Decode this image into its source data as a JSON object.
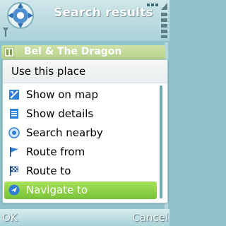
{
  "header": {
    "title": "Search results",
    "app_icon": "gps-globe-icon",
    "signal_icon": "signal-icon",
    "battery_icon": "battery-icon",
    "connection_icon": "connection-icon"
  },
  "list": {
    "items": [
      {
        "label": "Bel & The Dragon",
        "icon": "place-icon"
      }
    ]
  },
  "popup": {
    "title": "Use this place",
    "items": [
      {
        "label": "Show on map",
        "icon": "map-icon",
        "selected": false
      },
      {
        "label": "Show details",
        "icon": "details-icon",
        "selected": false
      },
      {
        "label": "Search nearby",
        "icon": "search-nearby-icon",
        "selected": false
      },
      {
        "label": "Route from",
        "icon": "flag-start-icon",
        "selected": false
      },
      {
        "label": "Route to",
        "icon": "flag-finish-icon",
        "selected": false
      },
      {
        "label": "Navigate to",
        "icon": "navigate-icon",
        "selected": true
      }
    ]
  },
  "softkeys": {
    "left": "OK",
    "right": "Cancel"
  },
  "colors": {
    "selection": "#77c337",
    "theme": "#a9d2d8"
  }
}
